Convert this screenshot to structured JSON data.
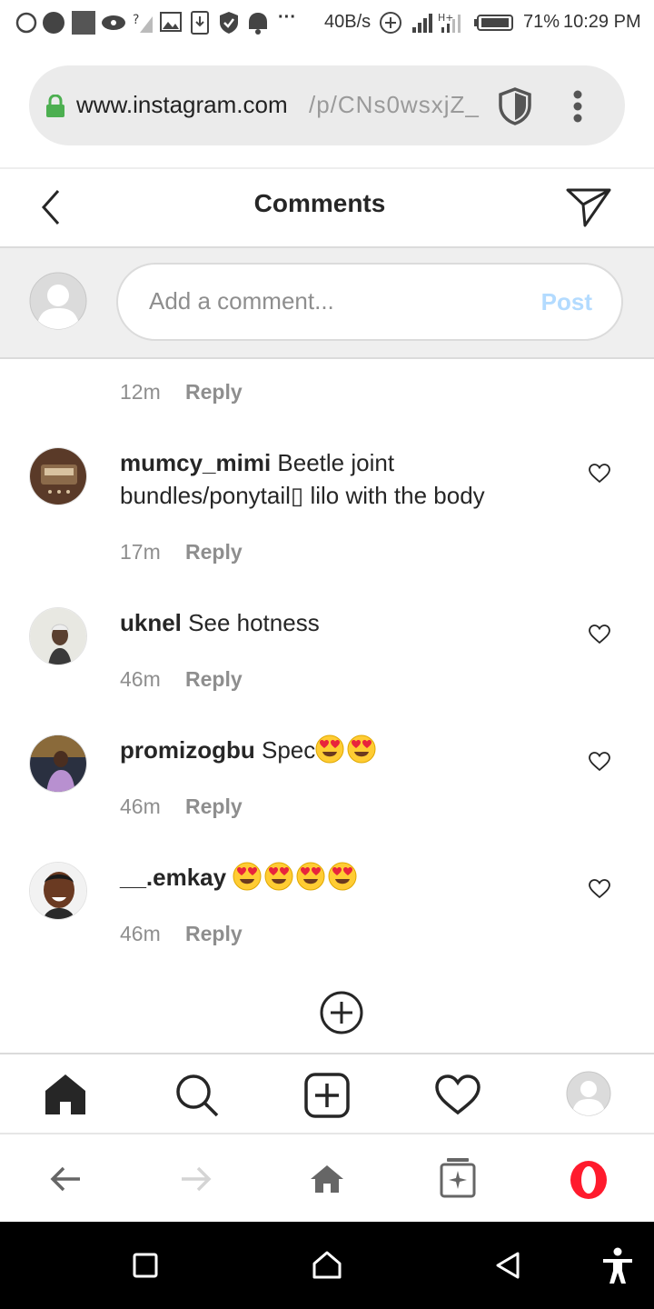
{
  "status_bar": {
    "speed": "40B/s",
    "battery": "71%",
    "time": "10:29 PM"
  },
  "browser": {
    "url_host": "www.instagram.com",
    "url_path": "/p/CNs0wsxjZ_",
    "icons": [
      "lock-icon",
      "shield-icon",
      "more-vertical-icon"
    ]
  },
  "header": {
    "title": "Comments",
    "icons": [
      "back-icon",
      "direct-send-icon"
    ]
  },
  "composer": {
    "placeholder": "Add a comment...",
    "post_label": "Post"
  },
  "comments": [
    {
      "time": "12m",
      "reply": "Reply"
    },
    {
      "username": "mumcy_mimi",
      "text": "Beetle joint bundles/ponytail▯ lilo with the body",
      "time": "17m",
      "reply": "Reply"
    },
    {
      "username": "uknel",
      "text": "See hotness",
      "time": "46m",
      "reply": "Reply"
    },
    {
      "username": "promizogbu",
      "text": "Spec",
      "emojis": 2,
      "time": "46m",
      "reply": "Reply"
    },
    {
      "username": "__.emkay",
      "text": "",
      "emojis": 4,
      "time": "46m",
      "reply": "Reply"
    }
  ],
  "colors": {
    "post_disabled": "#b3dbff",
    "secure_lock": "#4caf50",
    "opera_red": "#ff1b2d"
  },
  "ig_nav": [
    "home-icon",
    "search-icon",
    "new-post-icon",
    "activity-icon",
    "profile-icon"
  ],
  "browser_nav": [
    "back-arrow-icon",
    "forward-arrow-icon",
    "home-icon",
    "tabs-icon",
    "opera-icon"
  ],
  "android_nav": [
    "recents-icon",
    "home-icon",
    "back-icon",
    "accessibility-icon"
  ]
}
